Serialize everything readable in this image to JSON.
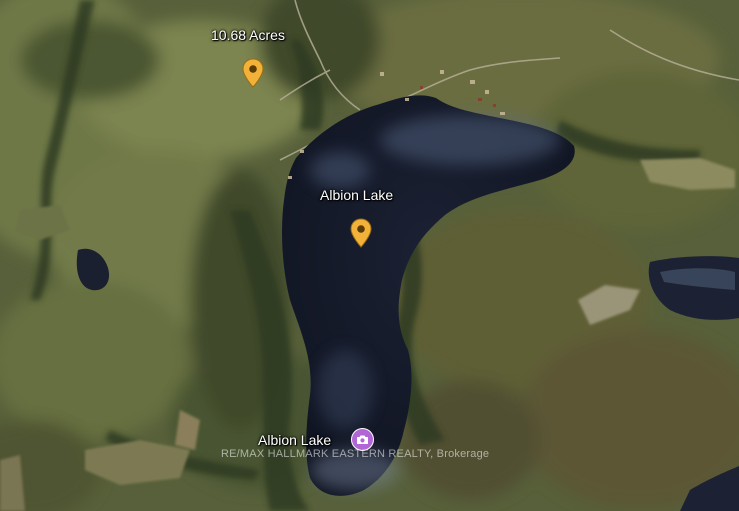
{
  "map": {
    "view": "satellite",
    "colors": {
      "water": "#161b2c",
      "forest": "#4d5630",
      "field": "#6f7a45",
      "marker": "#f2b23a"
    },
    "markers": [
      {
        "label": "10.68 Acres",
        "icon": "map-pin-icon"
      },
      {
        "label": "Albion Lake",
        "icon": "map-pin-icon"
      }
    ],
    "photo_marker": {
      "label": "Albion Lake",
      "icon": "camera-icon"
    },
    "watermark": "RE/MAX HALLMARK EASTERN REALTY, Brokerage"
  }
}
